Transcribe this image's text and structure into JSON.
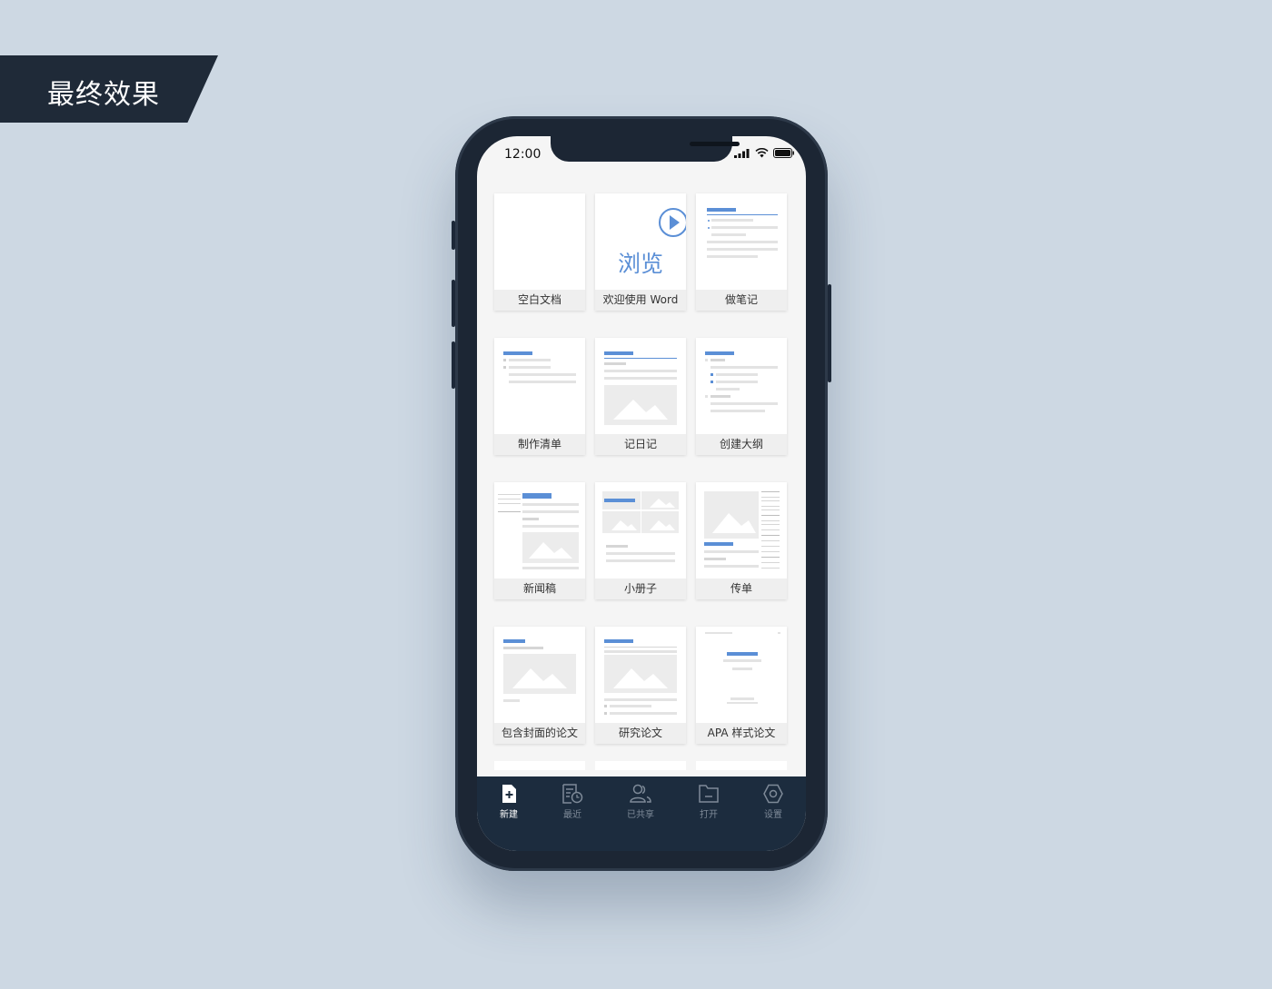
{
  "banner": {
    "title": "最终效果"
  },
  "status_bar": {
    "time": "12:00"
  },
  "templates": [
    {
      "label": "空白文档",
      "thumb": "blank"
    },
    {
      "label": "欢迎使用 Word",
      "thumb": "tour",
      "thumb_text": "浏览"
    },
    {
      "label": "做笔记",
      "thumb": "notes"
    },
    {
      "label": "制作清单",
      "thumb": "list"
    },
    {
      "label": "记日记",
      "thumb": "journal"
    },
    {
      "label": "创建大纲",
      "thumb": "outline"
    },
    {
      "label": "新闻稿",
      "thumb": "newsletter"
    },
    {
      "label": "小册子",
      "thumb": "brochure"
    },
    {
      "label": "传单",
      "thumb": "flyer"
    },
    {
      "label": "包含封面的论文",
      "thumb": "paper-cover"
    },
    {
      "label": "研究论文",
      "thumb": "research"
    },
    {
      "label": "APA 样式论文",
      "thumb": "apa"
    }
  ],
  "tabs": [
    {
      "label": "新建",
      "icon": "new-doc-icon",
      "active": true
    },
    {
      "label": "最近",
      "icon": "recent-icon",
      "active": false
    },
    {
      "label": "已共享",
      "icon": "shared-icon",
      "active": false
    },
    {
      "label": "打开",
      "icon": "folder-icon",
      "active": false
    },
    {
      "label": "设置",
      "icon": "settings-icon",
      "active": false
    }
  ],
  "colors": {
    "accent": "#5b8fd6",
    "tabbar": "#1c2c3e",
    "background": "#cdd8e3"
  }
}
